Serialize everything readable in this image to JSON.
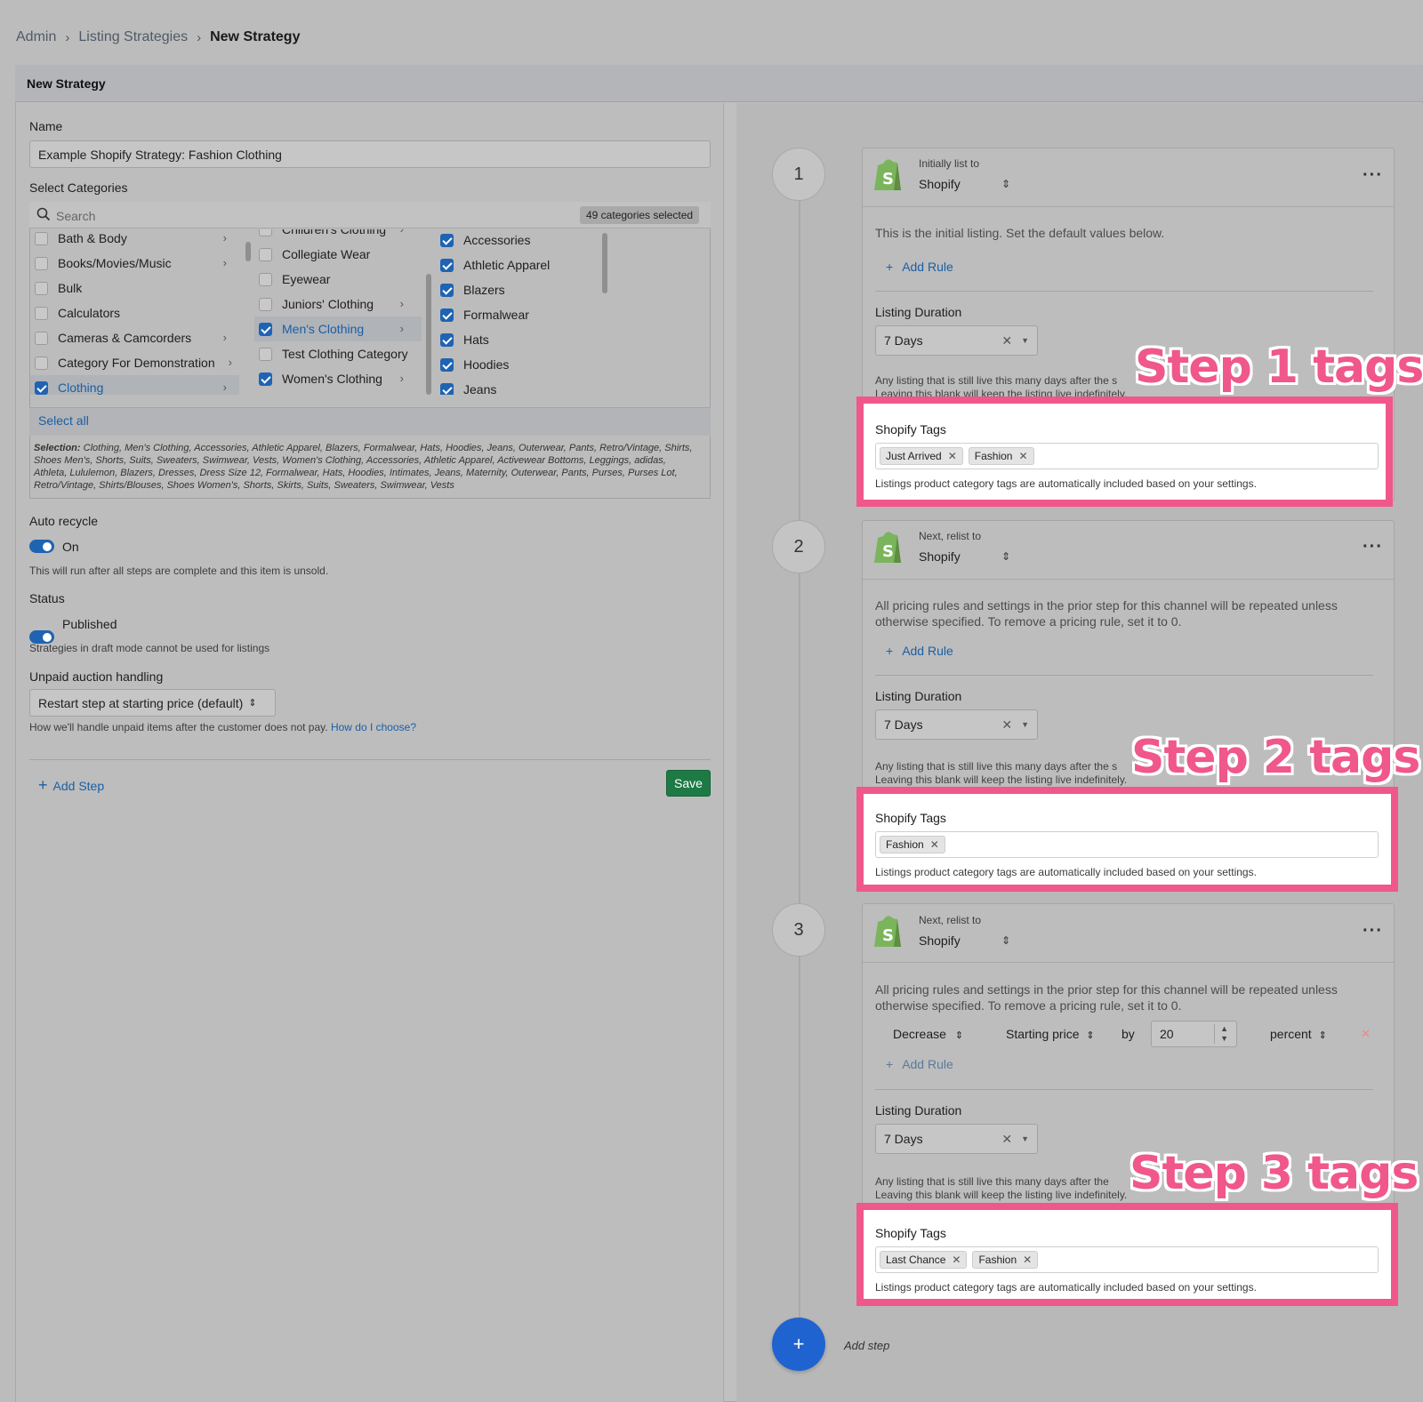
{
  "breadcrumb": {
    "items": [
      "Admin",
      "Listing Strategies"
    ],
    "current": "New Strategy"
  },
  "header": {
    "title": "New Strategy"
  },
  "form": {
    "name_label": "Name",
    "name_value": "Example Shopify Strategy: Fashion Clothing",
    "categories_label": "Select Categories",
    "search_placeholder": "Search",
    "selected_count": "49 categories selected",
    "col1": [
      "Bath & Body",
      "Books/Movies/Music",
      "Bulk",
      "Calculators",
      "Cameras & Camcorders",
      "Category For Demonstration",
      "Clothing"
    ],
    "col2": [
      "Children's Clothing",
      "Collegiate Wear",
      "Eyewear",
      "Juniors' Clothing",
      "Men's Clothing",
      "Test Clothing Category",
      "Women's Clothing"
    ],
    "col3": [
      "Accessories",
      "Athletic Apparel",
      "Blazers",
      "Formalwear",
      "Hats",
      "Hoodies",
      "Jeans"
    ],
    "select_all": "Select all",
    "selection_label": "Selection:",
    "selection_text": "Clothing, Men's Clothing, Accessories, Athletic Apparel, Blazers, Formalwear, Hats, Hoodies, Jeans, Outerwear, Pants, Retro/Vintage, Shirts, Shoes Men's, Shorts, Suits, Sweaters, Swimwear, Vests, Women's Clothing, Accessories, Athletic Apparel, Activewear Bottoms, Leggings, adidas, Athleta, Lululemon, Blazers, Dresses, Dress Size 12, Formalwear, Hats, Hoodies, Intimates, Jeans, Maternity, Outerwear, Pants, Purses, Purses Lot, Retro/Vintage, Shirts/Blouses, Shoes Women's, Shorts, Skirts, Suits, Sweaters, Swimwear, Vests",
    "auto_recycle_label": "Auto recycle",
    "auto_recycle_value": "On",
    "auto_recycle_note": "This will run after all steps are complete and this item is unsold.",
    "status_label": "Status",
    "status_value": "Published",
    "status_note": "Strategies in draft mode cannot be used for listings",
    "unpaid_label": "Unpaid auction handling",
    "unpaid_value": "Restart step at starting price (default)",
    "unpaid_note": "How we'll handle unpaid items after the customer does not pay.",
    "unpaid_link": "How do I choose?",
    "add_step": "Add Step",
    "save": "Save"
  },
  "steps": [
    {
      "number": "1",
      "kicker": "Initially list to",
      "channel": "Shopify",
      "desc": "This is the initial listing. Set the default values below.",
      "add_rule": "Add Rule",
      "duration_label": "Listing Duration",
      "duration_value": "7 Days",
      "duration_note_1": "Any listing that is still live this many days after the s",
      "duration_note_1b": "ted",
      "duration_note_2": "Leaving this blank will keep the listing live indefinitely.",
      "tags_label": "Shopify Tags",
      "tags": [
        "Just Arrived",
        "Fashion"
      ],
      "tags_note": "Listings product category tags are automatically included based on your settings.",
      "callout": "Step 1 tags"
    },
    {
      "number": "2",
      "kicker": "Next, relist to",
      "channel": "Shopify",
      "desc": "All pricing rules and settings in the prior step for this channel will be repeated unless otherwise specified. To remove a pricing rule, set it to 0.",
      "add_rule": "Add Rule",
      "duration_label": "Listing Duration",
      "duration_value": "7 Days",
      "duration_note_1": "Any listing that is still live this many days after the s",
      "duration_note_2": "Leaving this blank will keep the listing live indefinitely.",
      "tags_label": "Shopify Tags",
      "tags": [
        "Fashion"
      ],
      "tags_note": "Listings product category tags are automatically included based on your settings.",
      "callout": "Step 2 tags"
    },
    {
      "number": "3",
      "kicker": "Next, relist to",
      "channel": "Shopify",
      "desc": "All pricing rules and settings in the prior step for this channel will be repeated unless otherwise specified. To remove a pricing rule, set it to 0.",
      "rule": {
        "action": "Decrease",
        "field": "Starting price",
        "by": "by",
        "amount": "20",
        "unit": "percent"
      },
      "add_rule": "Add Rule",
      "duration_label": "Listing Duration",
      "duration_value": "7 Days",
      "duration_note_1": "Any listing that is still live this many days after the",
      "duration_note_2": "Leaving this blank will keep the listing live indefinitely.",
      "tags_label": "Shopify Tags",
      "tags": [
        "Last Chance",
        "Fashion"
      ],
      "tags_note": "Listings product category tags are automatically included based on your settings.",
      "callout": "Step 3 tags"
    }
  ],
  "fab": {
    "icon": "+",
    "label": "Add step"
  },
  "colors": {
    "accent": "#1f63b3",
    "save": "#1e7a45",
    "callout": "#f0578a",
    "shopify": "#7ab55c"
  }
}
